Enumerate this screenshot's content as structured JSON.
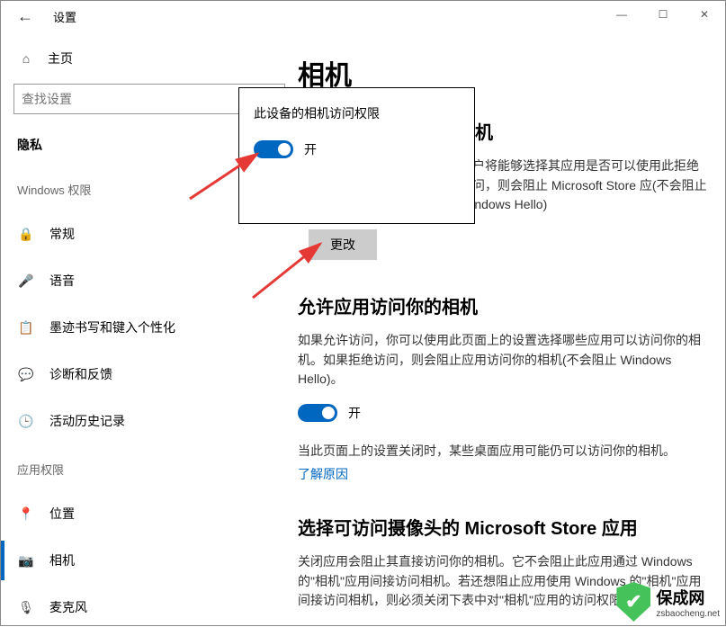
{
  "window": {
    "title": "设置"
  },
  "sidebar": {
    "home": "主页",
    "search_placeholder": "查找设置",
    "category": "隐私",
    "section1": "Windows 权限",
    "items1": [
      {
        "icon": "lock-icon",
        "glyph": "🔒",
        "label": "常规"
      },
      {
        "icon": "speech-icon",
        "glyph": "🎤",
        "label": "语音"
      },
      {
        "icon": "ink-icon",
        "glyph": "📋",
        "label": "墨迹书写和键入个性化"
      },
      {
        "icon": "feedback-icon",
        "glyph": "💬",
        "label": "诊断和反馈"
      },
      {
        "icon": "history-icon",
        "glyph": "🕒",
        "label": "活动历史记录"
      }
    ],
    "section2": "应用权限",
    "items2": [
      {
        "icon": "location-icon",
        "glyph": "📍",
        "label": "位置",
        "active": false
      },
      {
        "icon": "camera-icon",
        "glyph": "📷",
        "label": "相机",
        "active": true
      },
      {
        "icon": "microphone-icon",
        "glyph": "🎙",
        "label": "麦克风",
        "active": false
      }
    ]
  },
  "main": {
    "title": "相机",
    "sec1_title_partial": "相机",
    "desc1": "用户将能够选择其应用是否可以使用此拒绝访问，则会阻止 Microsoft Store 应(不会阻止 Windows Hello)",
    "change_btn": "更改",
    "sec2_title": "允许应用访问你的相机",
    "desc2": "如果允许访问，你可以使用此页面上的设置选择哪些应用可以访问你的相机。如果拒绝访问，则会阻止应用访问你的相机(不会阻止 Windows Hello)。",
    "toggle_label": "开",
    "note": "当此页面上的设置关闭时，某些桌面应用可能仍可以访问你的相机。",
    "learn_link": "了解原因",
    "sec3_title": "选择可访问摄像头的 Microsoft Store 应用",
    "desc3": "关闭应用会阻止其直接访问你的相机。它不会阻止此应用通过 Windows 的\"相机\"应用间接访问相机。若还想阻止应用使用 Windows 的\"相机\"应用间接访问相机，则必须关闭下表中对\"相机\"应用的访问权限。"
  },
  "dialog": {
    "title": "此设备的相机访问权限",
    "toggle_label": "开"
  },
  "watermark": {
    "text": "保成网",
    "url": "zsbaocheng.net"
  }
}
